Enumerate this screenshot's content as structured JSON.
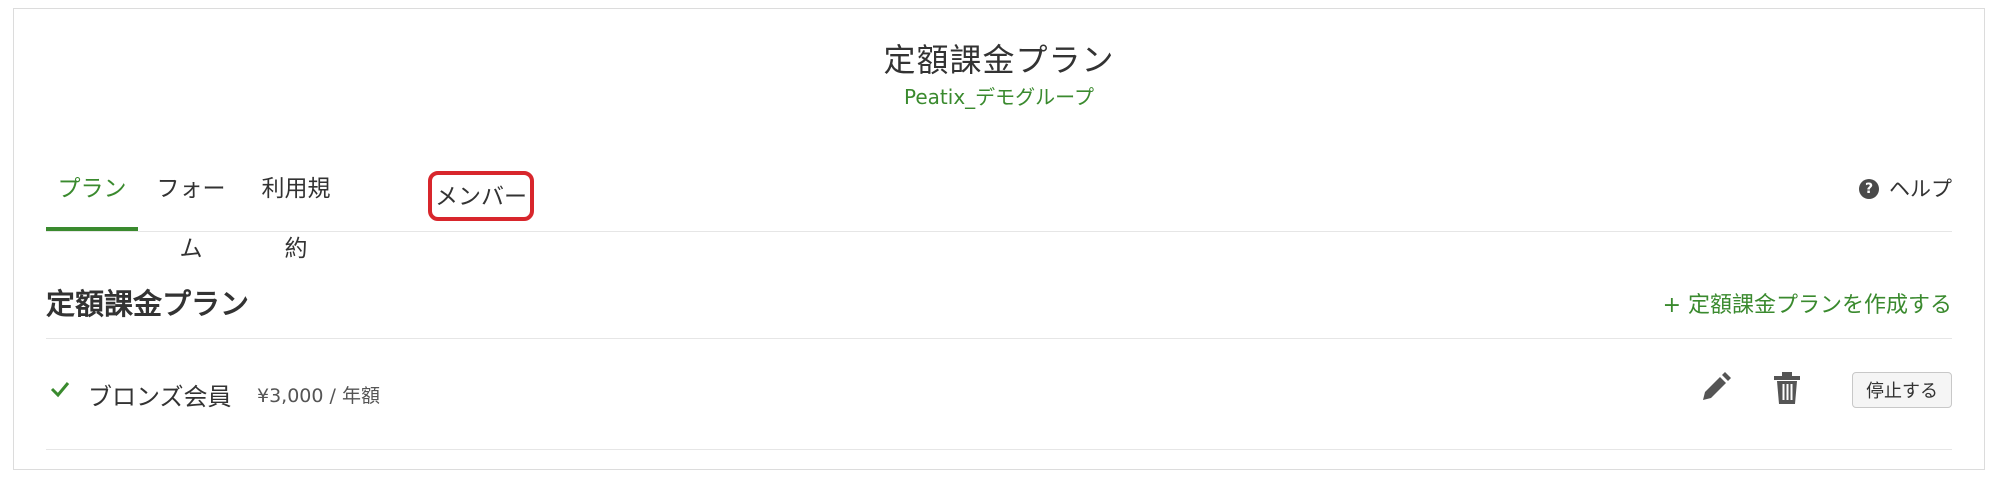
{
  "header": {
    "title": "定額課金プラン",
    "group_name": "Peatix_デモグループ"
  },
  "tabs": [
    {
      "label": "プラン",
      "active": true
    },
    {
      "label": "フォーム",
      "active": false
    },
    {
      "label": "利用規約",
      "active": false
    },
    {
      "label": "メンバー",
      "active": false,
      "highlighted": true
    }
  ],
  "help": {
    "icon": "question-circle-icon",
    "icon_glyph": "?",
    "label": "ヘルプ"
  },
  "section": {
    "title": "定額課金プラン",
    "create_link": "+ 定額課金プランを作成する"
  },
  "plans": [
    {
      "status_icon": "check-icon",
      "name": "ブロンズ会員",
      "price": "¥3,000 / 年額",
      "edit_icon": "pencil-icon",
      "delete_icon": "trash-icon",
      "stop_label": "停止する"
    }
  ],
  "colors": {
    "accent": "#3a8a2e",
    "highlight": "#d8262c"
  }
}
